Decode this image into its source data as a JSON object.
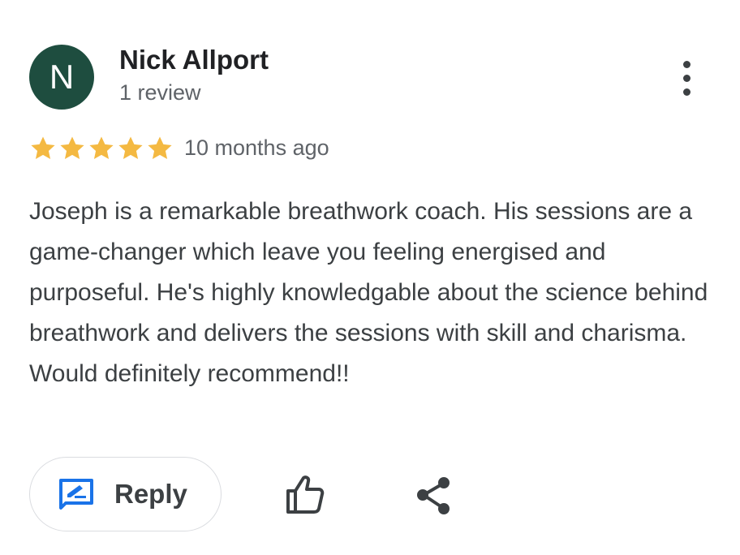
{
  "reviewer": {
    "initial": "N",
    "name": "Nick Allport",
    "review_count": "1 review",
    "avatar_color": "#1e4d3f"
  },
  "review": {
    "rating": 5,
    "max_rating": 5,
    "star_color": "#f4b942",
    "date": "10 months ago",
    "text": "Joseph is a remarkable breathwork coach. His sessions are a game-changer which leave you feeling energised and purposeful. He's highly knowledgable about the science behind breathwork and delivers the sessions with skill and charisma. Would definitely recommend!!"
  },
  "actions": {
    "reply_label": "Reply",
    "reply_icon": "edit-comment-icon",
    "reply_icon_color": "#1a73e8",
    "like_icon": "thumb-up-icon",
    "share_icon": "share-icon",
    "more_icon": "more-vertical-icon"
  }
}
